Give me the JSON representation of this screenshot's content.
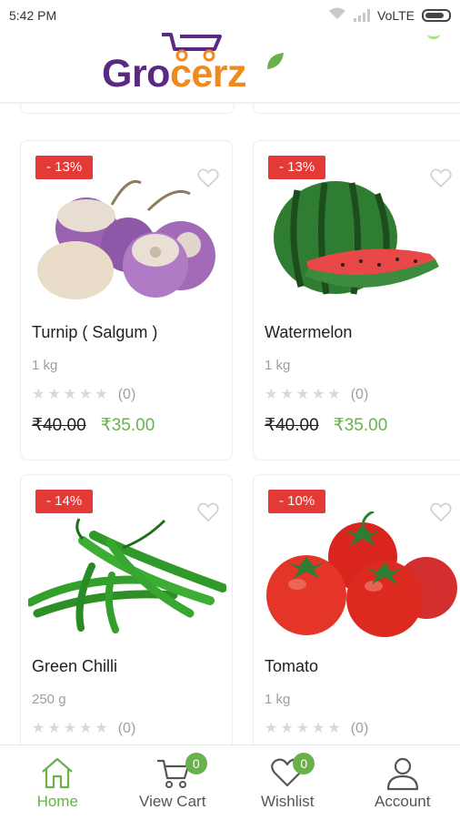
{
  "status_bar": {
    "time": "5:42 PM",
    "network": "VoLTE"
  },
  "brand": {
    "logo_part1": "Gro",
    "logo_part2": "cerz",
    "primary_color": "#5a2a82",
    "accent_color": "#f08a1d",
    "green": "#6ab04c"
  },
  "products": [
    {
      "discount": "- 13%",
      "name": "Turnip ( Salgum )",
      "quantity": "1 kg",
      "rating_count": "(0)",
      "old_price": "₹40.00",
      "new_price": "₹35.00",
      "image_icon": "turnip-image"
    },
    {
      "discount": "- 13%",
      "name": "Watermelon",
      "quantity": "1 kg",
      "rating_count": "(0)",
      "old_price": "₹40.00",
      "new_price": "₹35.00",
      "image_icon": "watermelon-image"
    },
    {
      "discount": "- 14%",
      "name": "Green Chilli",
      "quantity": "250 g",
      "rating_count": "(0)",
      "old_price": "",
      "new_price": "",
      "image_icon": "green-chilli-image"
    },
    {
      "discount": "- 10%",
      "name": "Tomato",
      "quantity": "1 kg",
      "rating_count": "(0)",
      "old_price": "",
      "new_price": "",
      "image_icon": "tomato-image"
    }
  ],
  "bottom_nav": {
    "items": [
      {
        "label": "Home",
        "icon": "home-icon",
        "active": true
      },
      {
        "label": "View Cart",
        "icon": "cart-icon",
        "badge": "0"
      },
      {
        "label": "Wishlist",
        "icon": "heart-icon",
        "badge": "0"
      },
      {
        "label": "Account",
        "icon": "person-icon"
      }
    ]
  }
}
